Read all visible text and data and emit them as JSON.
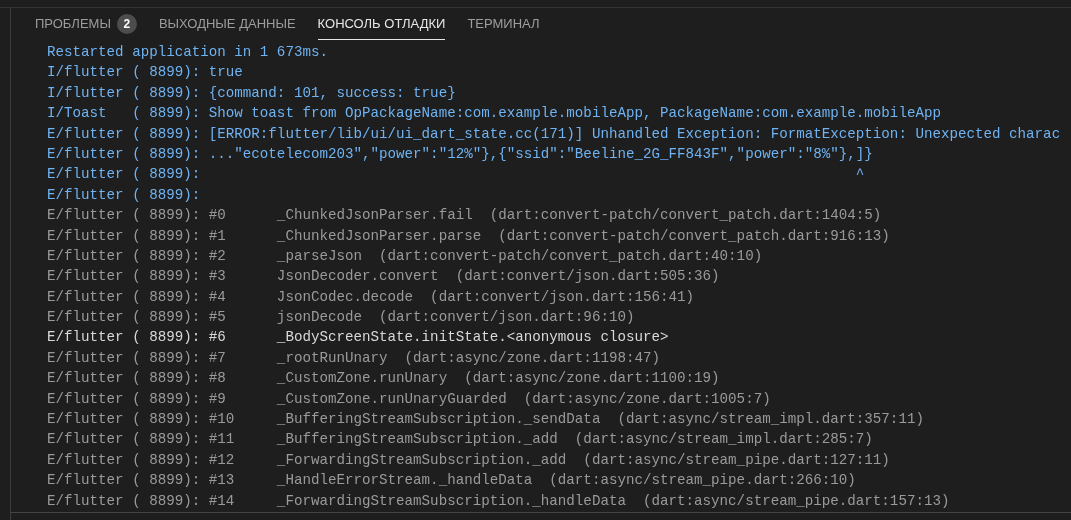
{
  "tabs": [
    {
      "label": "ПРОБЛЕМЫ",
      "badge": "2",
      "selected": false
    },
    {
      "label": "ВЫХОДНЫЕ ДАННЫЕ",
      "selected": false
    },
    {
      "label": "КОНСОЛЬ ОТЛАДКИ",
      "selected": true
    },
    {
      "label": "ТЕРМИНАЛ",
      "selected": false
    }
  ],
  "console_lines": [
    {
      "kind": "info",
      "text": "Restarted application in 1 673ms."
    },
    {
      "kind": "info",
      "text": "I/flutter ( 8899): true"
    },
    {
      "kind": "info",
      "text": "I/flutter ( 8899): {command: 101, success: true}"
    },
    {
      "kind": "info",
      "text": "I/Toast   ( 8899): Show toast from OpPackageName:com.example.mobileApp, PackageName:com.example.mobileApp"
    },
    {
      "kind": "info",
      "text": "E/flutter ( 8899): [ERROR:flutter/lib/ui/ui_dart_state.cc(171)] Unhandled Exception: FormatException: Unexpected charac"
    },
    {
      "kind": "info",
      "text": "E/flutter ( 8899): ...\"ecotelecom203\",\"power\":\"12%\"},{\"ssid\":\"Beeline_2G_FF843F\",\"power\":\"8%\"},]}"
    },
    {
      "kind": "info",
      "text": "E/flutter ( 8899):                                                                             ^"
    },
    {
      "kind": "info",
      "text": "E/flutter ( 8899):"
    },
    {
      "kind": "trace",
      "text": "E/flutter ( 8899): #0      _ChunkedJsonParser.fail  (dart:convert-patch/convert_patch.dart:1404:5)"
    },
    {
      "kind": "trace",
      "text": "E/flutter ( 8899): #1      _ChunkedJsonParser.parse  (dart:convert-patch/convert_patch.dart:916:13)"
    },
    {
      "kind": "trace",
      "text": "E/flutter ( 8899): #2      _parseJson  (dart:convert-patch/convert_patch.dart:40:10)"
    },
    {
      "kind": "trace",
      "text": "E/flutter ( 8899): #3      JsonDecoder.convert  (dart:convert/json.dart:505:36)"
    },
    {
      "kind": "trace",
      "text": "E/flutter ( 8899): #4      JsonCodec.decode  (dart:convert/json.dart:156:41)"
    },
    {
      "kind": "trace",
      "text": "E/flutter ( 8899): #5      jsonDecode  (dart:convert/json.dart:96:10)"
    },
    {
      "kind": "user",
      "text": "E/flutter ( 8899): #6      _BodyScreenState.initState.<anonymous closure>"
    },
    {
      "kind": "trace",
      "text": "E/flutter ( 8899): #7      _rootRunUnary  (dart:async/zone.dart:1198:47)"
    },
    {
      "kind": "trace",
      "text": "E/flutter ( 8899): #8      _CustomZone.runUnary  (dart:async/zone.dart:1100:19)"
    },
    {
      "kind": "trace",
      "text": "E/flutter ( 8899): #9      _CustomZone.runUnaryGuarded  (dart:async/zone.dart:1005:7)"
    },
    {
      "kind": "trace",
      "text": "E/flutter ( 8899): #10     _BufferingStreamSubscription._sendData  (dart:async/stream_impl.dart:357:11)"
    },
    {
      "kind": "trace",
      "text": "E/flutter ( 8899): #11     _BufferingStreamSubscription._add  (dart:async/stream_impl.dart:285:7)"
    },
    {
      "kind": "trace",
      "text": "E/flutter ( 8899): #12     _ForwardingStreamSubscription._add  (dart:async/stream_pipe.dart:127:11)"
    },
    {
      "kind": "trace",
      "text": "E/flutter ( 8899): #13     _HandleErrorStream._handleData  (dart:async/stream_pipe.dart:266:10)"
    },
    {
      "kind": "trace",
      "text": "E/flutter ( 8899): #14     _ForwardingStreamSubscription._handleData  (dart:async/stream_pipe.dart:157:13)"
    }
  ]
}
